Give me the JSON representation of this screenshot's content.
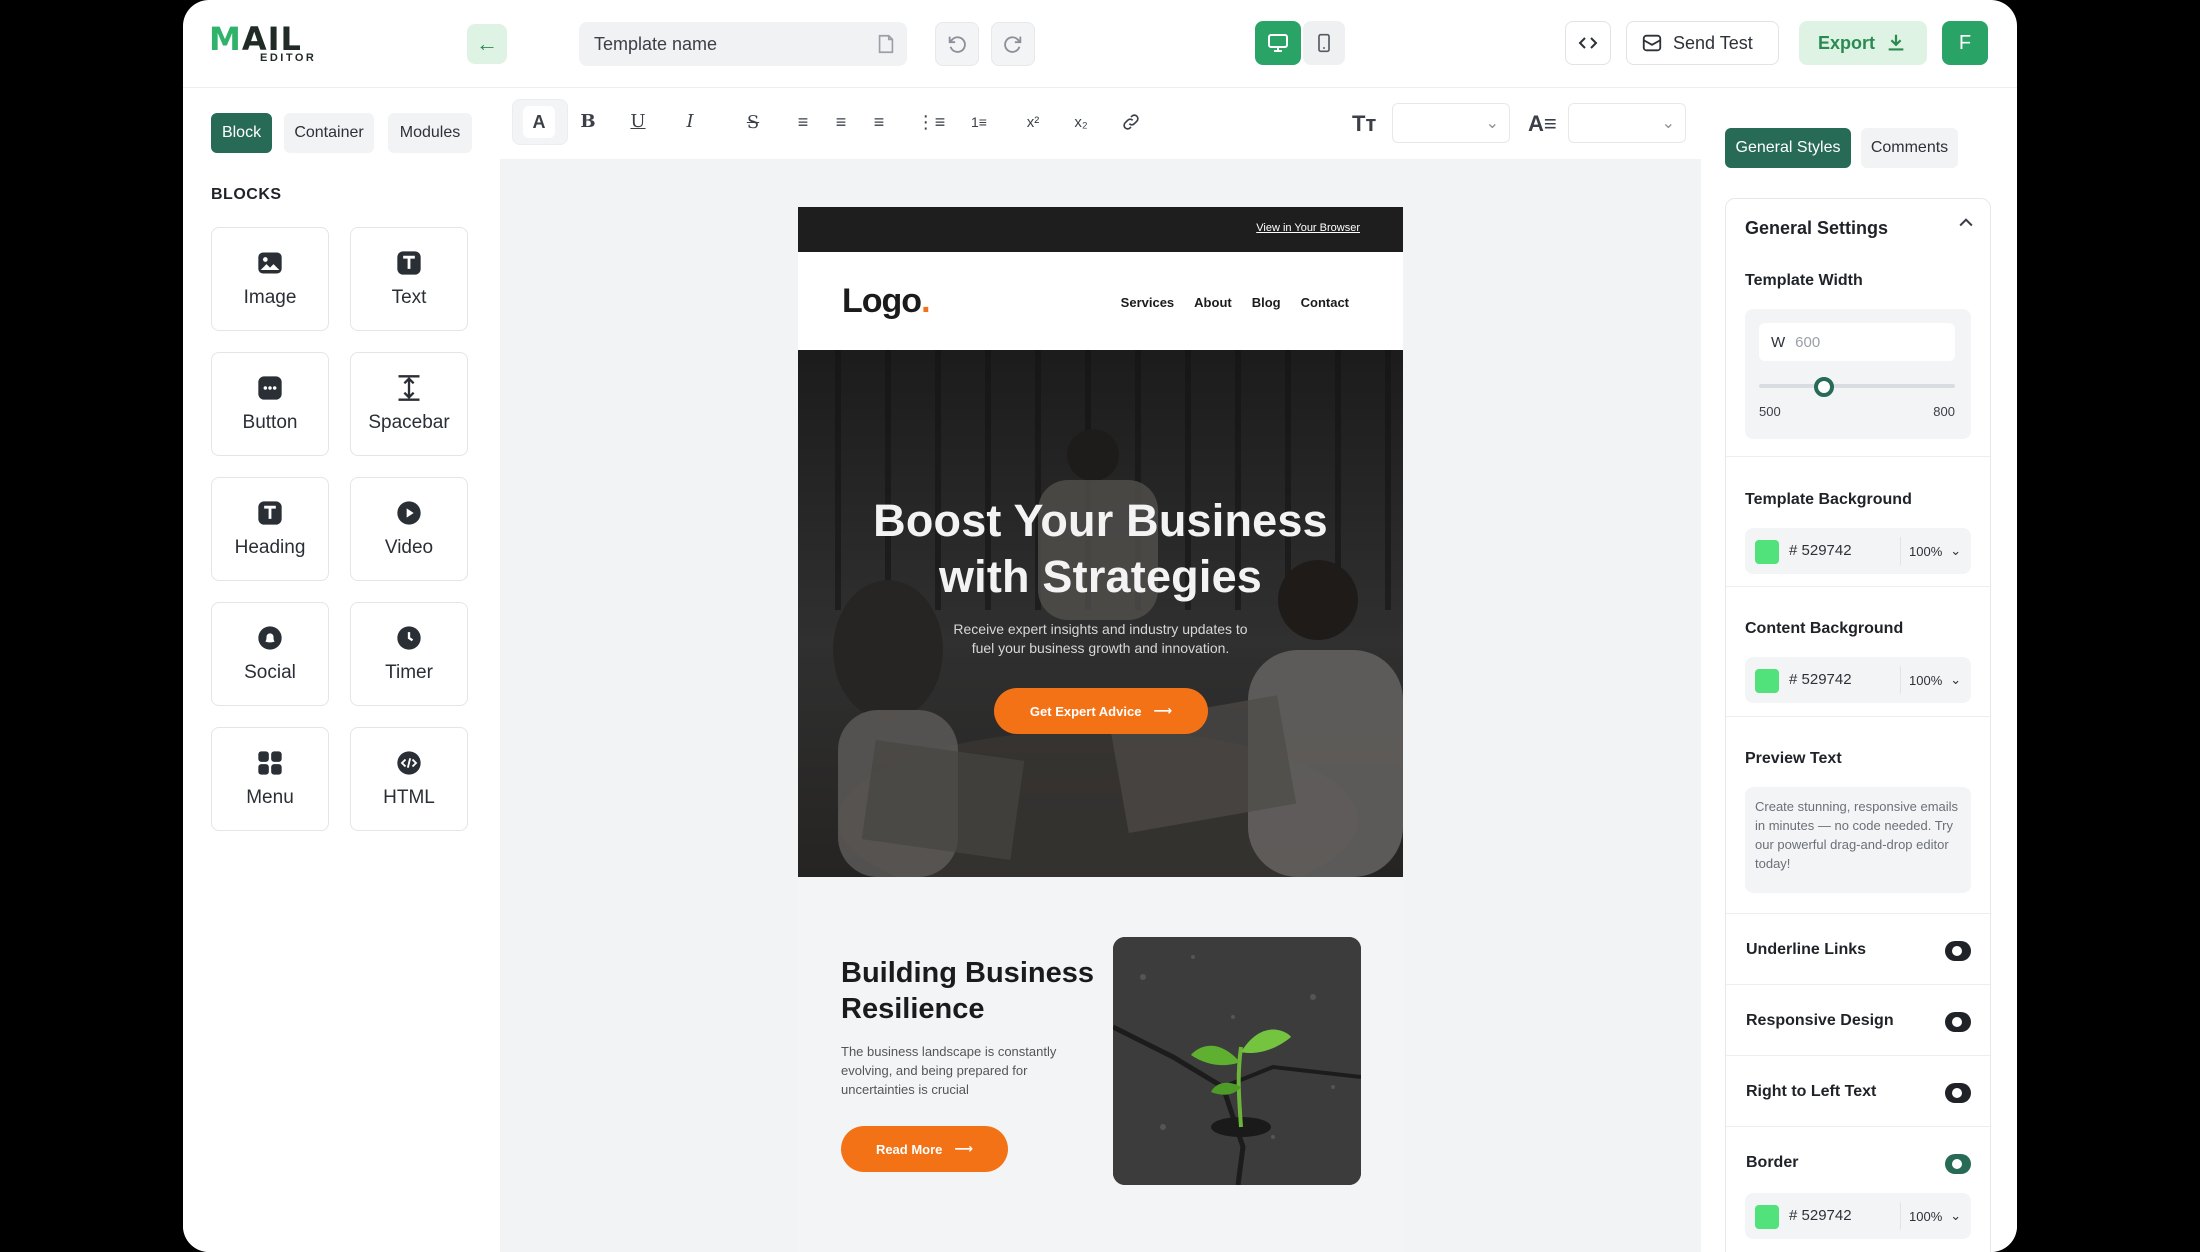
{
  "topbar": {
    "logo_main": "MAIL",
    "logo_sub": "EDITOR",
    "template_name_placeholder": "Template name",
    "send_test_label": "Send Test",
    "export_label": "Export",
    "avatar_initial": "F"
  },
  "left": {
    "tabs": [
      "Block",
      "Container",
      "Modules"
    ],
    "active_tab": "Block",
    "blocks_title": "BLOCKS",
    "blocks": [
      {
        "label": "Image",
        "icon": "image-icon"
      },
      {
        "label": "Text",
        "icon": "text-icon"
      },
      {
        "label": "Button",
        "icon": "button-icon"
      },
      {
        "label": "Spacebar",
        "icon": "spacebar-icon"
      },
      {
        "label": "Heading",
        "icon": "heading-icon"
      },
      {
        "label": "Video",
        "icon": "video-icon"
      },
      {
        "label": "Social",
        "icon": "social-icon"
      },
      {
        "label": "Timer",
        "icon": "timer-icon"
      },
      {
        "label": "Menu",
        "icon": "menu-icon"
      },
      {
        "label": "HTML",
        "icon": "html-icon"
      }
    ]
  },
  "email": {
    "view_in_browser": "View in Your Browser",
    "logo_text": "Logo",
    "logo_dot": ".",
    "nav": [
      "Services",
      "About",
      "Blog",
      "Contact"
    ],
    "hero_title_line1": "Boost Your Business",
    "hero_title_line2": "with Strategies",
    "hero_sub_line1": "Receive expert insights and industry updates to",
    "hero_sub_line2": "fuel your business growth and innovation.",
    "hero_button": "Get Expert Advice",
    "section_title": "Building Business Resilience",
    "section_text": "The business landscape is constantly evolving, and being prepared for uncertainties is crucial",
    "section_button": "Read More"
  },
  "right": {
    "tabs": [
      "General Styles",
      "Comments"
    ],
    "active_tab": "General Styles",
    "general_settings": "General Settings",
    "template_width_label": "Template Width",
    "width_prefix": "W",
    "width_value": "600",
    "width_min": "500",
    "width_max": "800",
    "width_slider_fraction": 0.33,
    "template_background_label": "Template Background",
    "template_background_hex": "# 529742",
    "template_background_opacity": "100%",
    "content_background_label": "Content Background",
    "content_background_hex": "# 529742",
    "content_background_opacity": "100%",
    "preview_text_label": "Preview Text",
    "preview_text_value": "Create stunning, responsive emails in minutes — no code needed. Try our powerful drag-and-drop editor today!",
    "underline_links_label": "Underline Links",
    "responsive_design_label": "Responsive Design",
    "rtl_label": "Right to Left Text",
    "border_label": "Border",
    "border_hex": "# 529742",
    "border_opacity": "100%"
  },
  "colors": {
    "brand_green": "#276b56",
    "accent_green": "#2aa366",
    "cta_orange": "#f47216",
    "swatch_green": "#52e27b"
  }
}
